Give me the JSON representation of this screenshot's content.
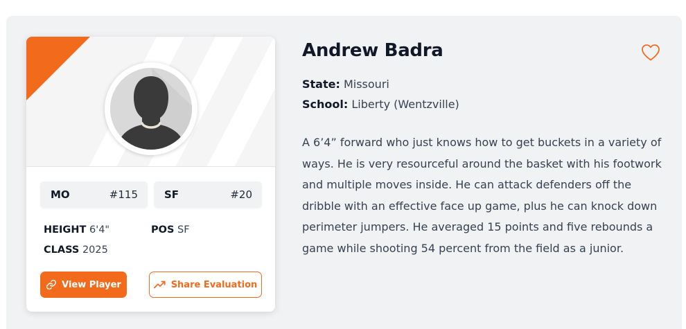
{
  "player": {
    "name": "Andrew Badra",
    "state_label": "State:",
    "state": "Missouri",
    "school_label": "School:",
    "school": "Liberty (Wentzville)",
    "bio": "A 6’4” forward who just knows how to get buckets in a variety of ways. He is very resourceful around the basket with his footwork and multiple moves inside. He can attack defenders off the dribble with an effective face up game, plus he can knock down perimeter jumpers. He averaged 15 points and five rebounds a game while shooting 54 percent from the field as a junior."
  },
  "card": {
    "state_rank": {
      "abbr": "MO",
      "rank": "#115"
    },
    "position_rank": {
      "abbr": "SF",
      "rank": "#20"
    },
    "height_label": "HEIGHT",
    "height": "6'4\"",
    "pos_label": "POS",
    "pos": "SF",
    "class_label": "CLASS",
    "class_year": "2025",
    "view_button": "View Player",
    "share_button": "Share Evaluation"
  },
  "icons": {
    "favorite": "heart-icon",
    "view": "link-icon",
    "share": "trending-up-icon",
    "avatar": "default-avatar-icon"
  },
  "colors": {
    "accent": "#f26b1d",
    "panel_bg": "#f1f2f4",
    "text_dark": "#111827"
  }
}
